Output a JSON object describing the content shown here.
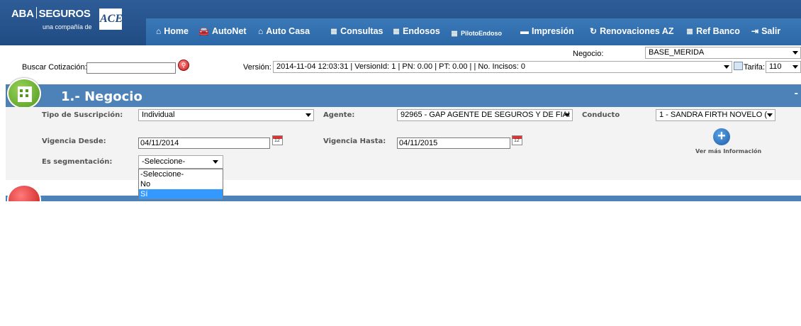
{
  "brand": {
    "name_left": "ABA",
    "name_right": "SEGUROS",
    "tagline": "una compañía de",
    "mark": "ACE"
  },
  "nav": [
    {
      "label": "Home",
      "icon": "home-icon"
    },
    {
      "label": "AutoNet",
      "icon": "car-icon"
    },
    {
      "label": "Auto Casa",
      "icon": "house-icon"
    },
    {
      "label": "Consultas",
      "icon": "document-icon"
    },
    {
      "label": "Endosos",
      "icon": "document-icon"
    },
    {
      "label": "PilotoEndoso",
      "icon": "document-icon"
    },
    {
      "label": "Impresión",
      "icon": "printer-icon"
    },
    {
      "label": "Renovaciones AZ",
      "icon": "refresh-icon"
    },
    {
      "label": "Ref Banco",
      "icon": "document-icon"
    },
    {
      "label": "Salir",
      "icon": "exit-icon"
    }
  ],
  "toolbar": {
    "negocio_label": "Negocio:",
    "negocio_value": "BASE_MERIDA",
    "buscar_label": "Buscar Cotización:",
    "buscar_value": "",
    "version_label": "Versión:",
    "version_value": "2014-11-04 12:03:31 | VersionId: 1 | PN: 0.00 | PT: 0.00 | | No. Incisos: 0",
    "tarifa_label": "Tarifa:",
    "tarifa_value": "110"
  },
  "section": {
    "title": "1.- Negocio",
    "collapse": "-"
  },
  "form": {
    "tipo_label": "Tipo de Suscripción:",
    "tipo_value": "Individual",
    "agente_label": "Agente:",
    "agente_value": "92965 - GAP AGENTE DE SEGUROS Y DE FIAI",
    "conducto_label": "Conducto",
    "conducto_value": "1 - SANDRA FIRTH NOVELO (",
    "desde_label": "Vigencia Desde:",
    "desde_value": "04/11/2014",
    "hasta_label": "Vigencia Hasta:",
    "hasta_value": "04/11/2015",
    "seg_label": "Es segmentación:",
    "seg_value": "-Seleccione-",
    "seg_options": [
      "-Seleccione-",
      "No",
      "Sí"
    ],
    "more_info": "Ver más Información",
    "calendar_day": "12"
  }
}
